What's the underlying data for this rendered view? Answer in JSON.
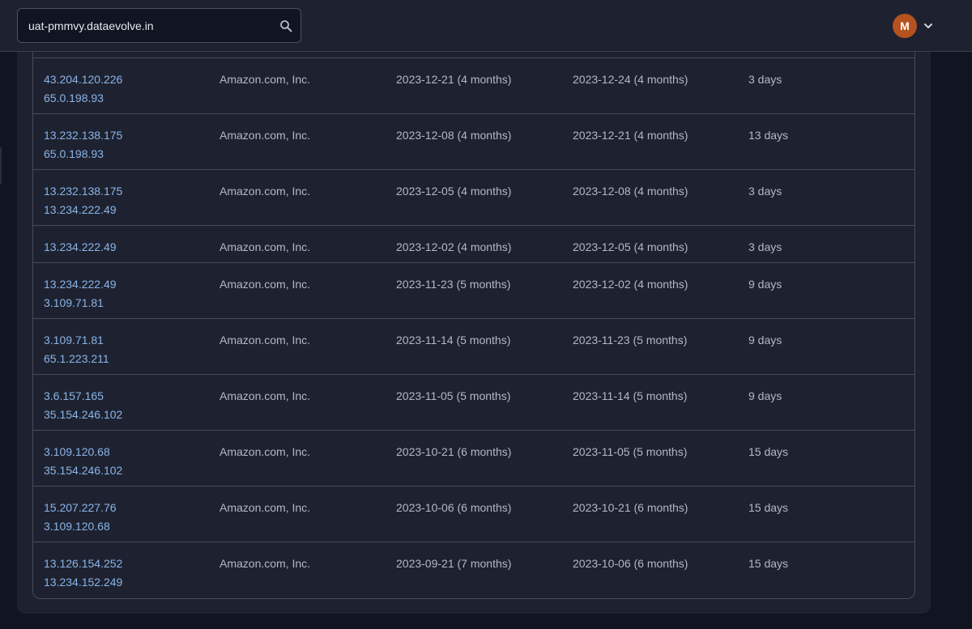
{
  "header": {
    "search_value": "uat-pmmvy.dataevolve.in",
    "search_icon": "search-icon",
    "avatar_initial": "M",
    "avatar_color": "#b5521f",
    "menu_icon": "chevron-down-icon"
  },
  "colors": {
    "link": "#8ab4e8",
    "text": "#b3b8c4",
    "background": "#111522",
    "card": "#1e2230"
  },
  "table": {
    "rows": [
      {
        "ips": [
          "43.204.120.226",
          "65.0.198.93"
        ],
        "org": "Amazon.com, Inc.",
        "first_seen": "2023-12-21 (4 months)",
        "last_seen": "2023-12-24 (4 months)",
        "duration": "3 days"
      },
      {
        "ips": [
          "13.232.138.175",
          "65.0.198.93"
        ],
        "org": "Amazon.com, Inc.",
        "first_seen": "2023-12-08 (4 months)",
        "last_seen": "2023-12-21 (4 months)",
        "duration": "13 days"
      },
      {
        "ips": [
          "13.232.138.175",
          "13.234.222.49"
        ],
        "org": "Amazon.com, Inc.",
        "first_seen": "2023-12-05 (4 months)",
        "last_seen": "2023-12-08 (4 months)",
        "duration": "3 days"
      },
      {
        "ips": [
          "13.234.222.49"
        ],
        "org": "Amazon.com, Inc.",
        "first_seen": "2023-12-02 (4 months)",
        "last_seen": "2023-12-05 (4 months)",
        "duration": "3 days"
      },
      {
        "ips": [
          "13.234.222.49",
          "3.109.71.81"
        ],
        "org": "Amazon.com, Inc.",
        "first_seen": "2023-11-23 (5 months)",
        "last_seen": "2023-12-02 (4 months)",
        "duration": "9 days"
      },
      {
        "ips": [
          "3.109.71.81",
          "65.1.223.211"
        ],
        "org": "Amazon.com, Inc.",
        "first_seen": "2023-11-14 (5 months)",
        "last_seen": "2023-11-23 (5 months)",
        "duration": "9 days"
      },
      {
        "ips": [
          "3.6.157.165",
          "35.154.246.102"
        ],
        "org": "Amazon.com, Inc.",
        "first_seen": "2023-11-05 (5 months)",
        "last_seen": "2023-11-14 (5 months)",
        "duration": "9 days"
      },
      {
        "ips": [
          "3.109.120.68",
          "35.154.246.102"
        ],
        "org": "Amazon.com, Inc.",
        "first_seen": "2023-10-21 (6 months)",
        "last_seen": "2023-11-05 (5 months)",
        "duration": "15 days"
      },
      {
        "ips": [
          "15.207.227.76",
          "3.109.120.68"
        ],
        "org": "Amazon.com, Inc.",
        "first_seen": "2023-10-06 (6 months)",
        "last_seen": "2023-10-21 (6 months)",
        "duration": "15 days"
      },
      {
        "ips": [
          "13.126.154.252",
          "13.234.152.249"
        ],
        "org": "Amazon.com, Inc.",
        "first_seen": "2023-09-21 (7 months)",
        "last_seen": "2023-10-06 (6 months)",
        "duration": "15 days"
      }
    ]
  }
}
